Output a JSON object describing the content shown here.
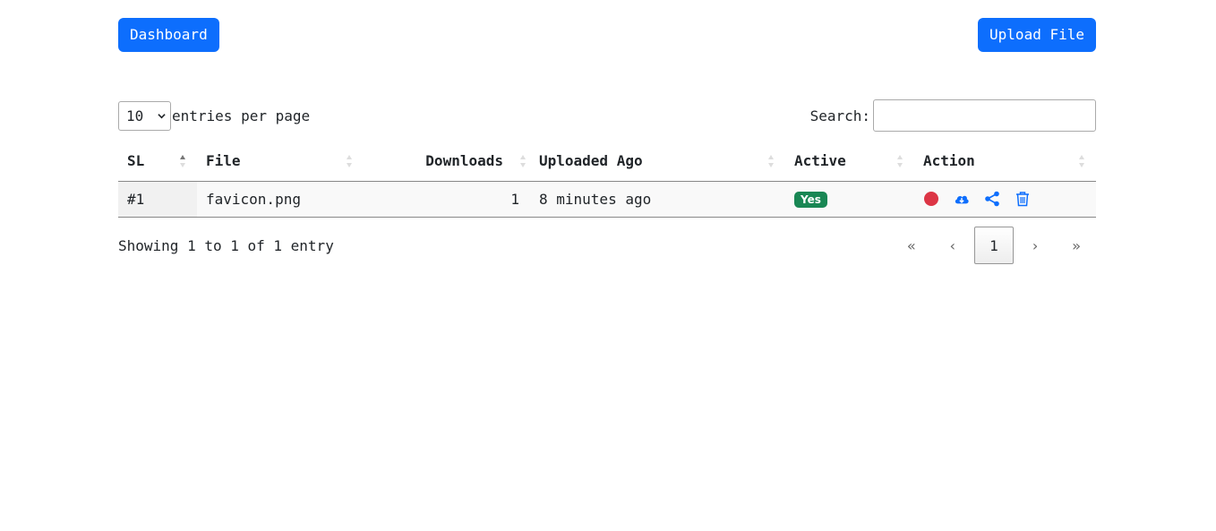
{
  "header": {
    "dashboard_label": "Dashboard",
    "upload_label": "Upload File"
  },
  "controls": {
    "page_length": "10",
    "page_length_label": "entries per page",
    "search_label": "Search:",
    "search_value": ""
  },
  "table": {
    "columns": [
      "SL",
      "File",
      "Downloads",
      "Uploaded Ago",
      "Active",
      "Action"
    ],
    "rows": [
      {
        "sl": "#1",
        "file": "favicon.png",
        "downloads": "1",
        "uploaded_ago": "8 minutes ago",
        "active": "Yes"
      }
    ]
  },
  "footer": {
    "info": "Showing 1 to 1 of 1 entry",
    "first": "«",
    "prev": "‹",
    "current_page": "1",
    "next": "›",
    "last": "»"
  },
  "colors": {
    "primary": "#0d6efd",
    "success": "#198754",
    "danger": "#dc3545"
  },
  "icons": [
    "record-icon",
    "cloud-download-icon",
    "share-icon",
    "trash-icon"
  ]
}
